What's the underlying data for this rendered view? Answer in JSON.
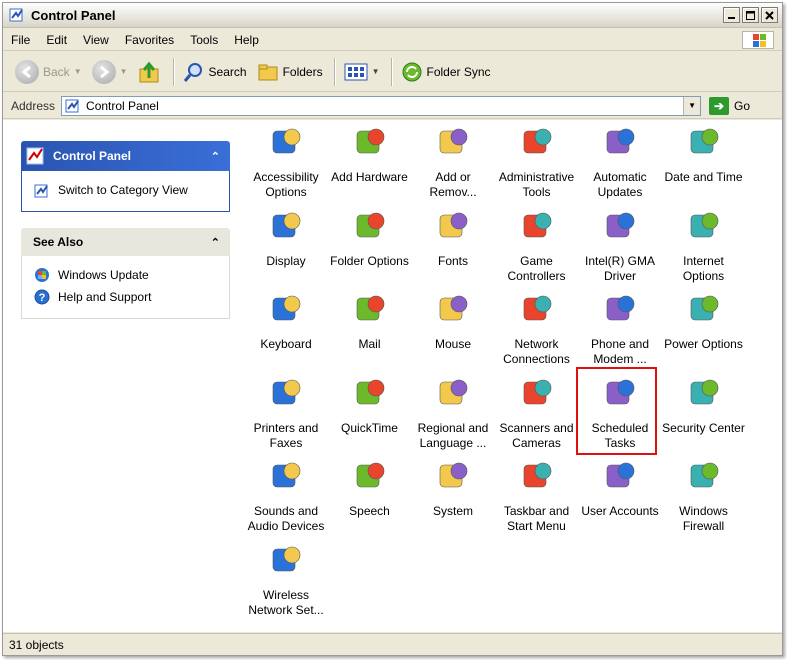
{
  "window": {
    "title": "Control Panel"
  },
  "menu": [
    "File",
    "Edit",
    "View",
    "Favorites",
    "Tools",
    "Help"
  ],
  "toolbar": {
    "back": "Back",
    "search": "Search",
    "folders": "Folders",
    "folder_sync": "Folder Sync"
  },
  "address": {
    "label": "Address",
    "value": "Control Panel",
    "go": "Go"
  },
  "sidebar": {
    "control_panel": {
      "title": "Control Panel",
      "link": "Switch to Category View"
    },
    "see_also": {
      "title": "See Also",
      "links": [
        "Windows Update",
        "Help and Support"
      ]
    }
  },
  "items": [
    {
      "label": "Accessibility Options",
      "icon": "accessibility-icon"
    },
    {
      "label": "Add Hardware",
      "icon": "add-hardware-icon"
    },
    {
      "label": "Add or Remov...",
      "icon": "add-remove-programs-icon"
    },
    {
      "label": "Administrative Tools",
      "icon": "administrative-tools-icon"
    },
    {
      "label": "Automatic Updates",
      "icon": "automatic-updates-icon"
    },
    {
      "label": "Date and Time",
      "icon": "date-time-icon"
    },
    {
      "label": "Display",
      "icon": "display-icon"
    },
    {
      "label": "Folder Options",
      "icon": "folder-options-icon"
    },
    {
      "label": "Fonts",
      "icon": "fonts-icon"
    },
    {
      "label": "Game Controllers",
      "icon": "game-controllers-icon"
    },
    {
      "label": "Intel(R) GMA Driver",
      "icon": "intel-gma-icon"
    },
    {
      "label": "Internet Options",
      "icon": "internet-options-icon"
    },
    {
      "label": "Keyboard",
      "icon": "keyboard-icon"
    },
    {
      "label": "Mail",
      "icon": "mail-icon"
    },
    {
      "label": "Mouse",
      "icon": "mouse-icon"
    },
    {
      "label": "Network Connections",
      "icon": "network-connections-icon"
    },
    {
      "label": "Phone and Modem ...",
      "icon": "phone-modem-icon"
    },
    {
      "label": "Power Options",
      "icon": "power-options-icon"
    },
    {
      "label": "Printers and Faxes",
      "icon": "printers-faxes-icon"
    },
    {
      "label": "QuickTime",
      "icon": "quicktime-icon"
    },
    {
      "label": "Regional and Language ...",
      "icon": "regional-language-icon"
    },
    {
      "label": "Scanners and Cameras",
      "icon": "scanners-cameras-icon"
    },
    {
      "label": "Scheduled Tasks",
      "icon": "scheduled-tasks-icon",
      "highlighted": true
    },
    {
      "label": "Security Center",
      "icon": "security-center-icon"
    },
    {
      "label": "Sounds and Audio Devices",
      "icon": "sounds-audio-icon"
    },
    {
      "label": "Speech",
      "icon": "speech-icon"
    },
    {
      "label": "System",
      "icon": "system-icon"
    },
    {
      "label": "Taskbar and Start Menu",
      "icon": "taskbar-start-menu-icon"
    },
    {
      "label": "User Accounts",
      "icon": "user-accounts-icon"
    },
    {
      "label": "Windows Firewall",
      "icon": "windows-firewall-icon"
    },
    {
      "label": "Wireless Network Set...",
      "icon": "wireless-network-icon"
    }
  ],
  "status": {
    "text": "31 objects"
  },
  "colors": {
    "highlight": "#e01010",
    "panel_blue": "#2a54b0"
  }
}
